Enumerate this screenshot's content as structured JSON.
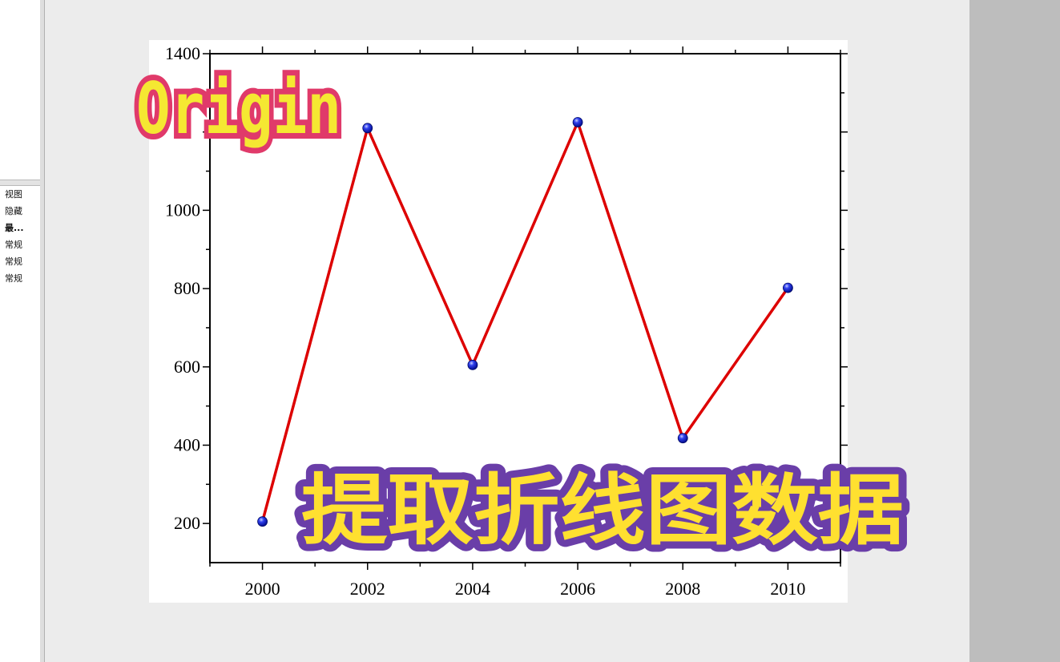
{
  "sidebar": {
    "items": [
      {
        "label": "视图",
        "bold": false
      },
      {
        "label": "隐藏",
        "bold": false
      },
      {
        "label": "最...",
        "bold": true
      },
      {
        "label": "常规",
        "bold": false
      },
      {
        "label": "常规",
        "bold": false
      },
      {
        "label": "常规",
        "bold": false
      }
    ]
  },
  "overlay": {
    "badge_text": "Origin",
    "caption_text": "提取折线图数据"
  },
  "colors": {
    "line": "#dd0000",
    "marker": "#1010cc",
    "badge_fill": "#f5e832",
    "badge_outline": "#e03a6a",
    "caption_fill": "#ffe030",
    "caption_outline": "#6a3ea8"
  },
  "chart_data": {
    "type": "line",
    "x": [
      2000,
      2002,
      2004,
      2006,
      2008,
      2010
    ],
    "series": [
      {
        "values": [
          205,
          1210,
          605,
          1225,
          418,
          802
        ]
      }
    ],
    "xlim": [
      1999,
      2011
    ],
    "ylim": [
      100,
      1400
    ],
    "xticks": [
      2000,
      2002,
      2004,
      2006,
      2008,
      2010
    ],
    "yticks": [
      200,
      400,
      600,
      800,
      1000,
      1400
    ],
    "title": "",
    "xlabel": "",
    "ylabel": "",
    "grid": false,
    "markers": true
  }
}
